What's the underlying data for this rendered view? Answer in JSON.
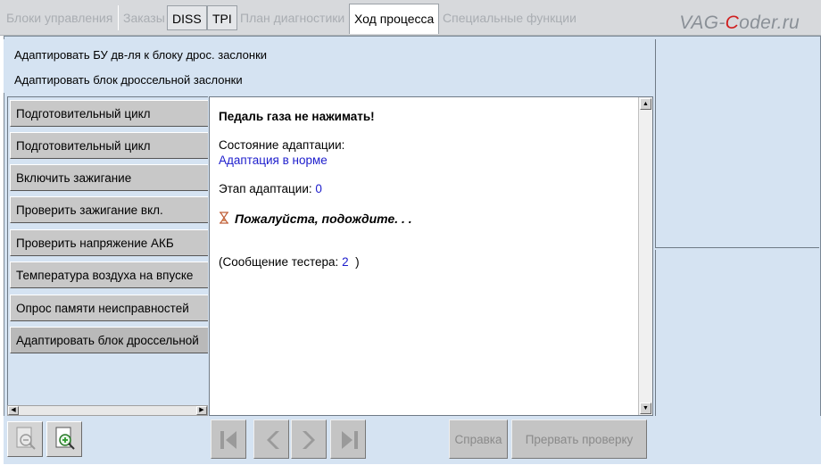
{
  "tabs": [
    {
      "label": "Блоки управления",
      "state": "disabled"
    },
    {
      "label": "Заказы",
      "state": "disabled"
    },
    {
      "label": "DISS",
      "state": "enabled"
    },
    {
      "label": "TPI",
      "state": "enabled"
    },
    {
      "label": "План диагностики",
      "state": "disabled"
    },
    {
      "label": "Ход процесса",
      "state": "active"
    },
    {
      "label": "Специальные функции",
      "state": "disabled"
    }
  ],
  "logo": {
    "before": "VAG-",
    "accent": "C",
    "after": "oder.ru",
    "accent_color": "#d02020"
  },
  "header": {
    "line1": "Адаптировать БУ дв-ля к блоку дрос. заслонки",
    "line2": "Адаптировать блок дроссельной заслонки"
  },
  "steps": [
    "Подготовительный цикл",
    "Подготовительный цикл",
    "Включить зажигание",
    "Проверить зажигание вкл.",
    "Проверить напряжение АКБ",
    "Температура воздуха на впуске",
    "Опрос памяти неисправностей",
    "Адаптировать блок дроссельной"
  ],
  "content": {
    "instruction": "Педаль газа не нажимать!",
    "state_label": "Состояние адаптации:",
    "state_value": "Адаптация в норме",
    "stage_label": "Этап адаптации:",
    "stage_value": "0",
    "wait_text": "Пожалуйста, подождите. . .",
    "tester_prefix": "(Сообщение тестера:",
    "tester_value": "2",
    "tester_suffix": ")"
  },
  "toolbar": {
    "help_label": "Справка",
    "abort_label": "Прервать проверку"
  },
  "colors": {
    "panel_bg": "#d5e3f2",
    "link_blue": "#1c1ccc",
    "disabled_text": "#a9adb2"
  }
}
